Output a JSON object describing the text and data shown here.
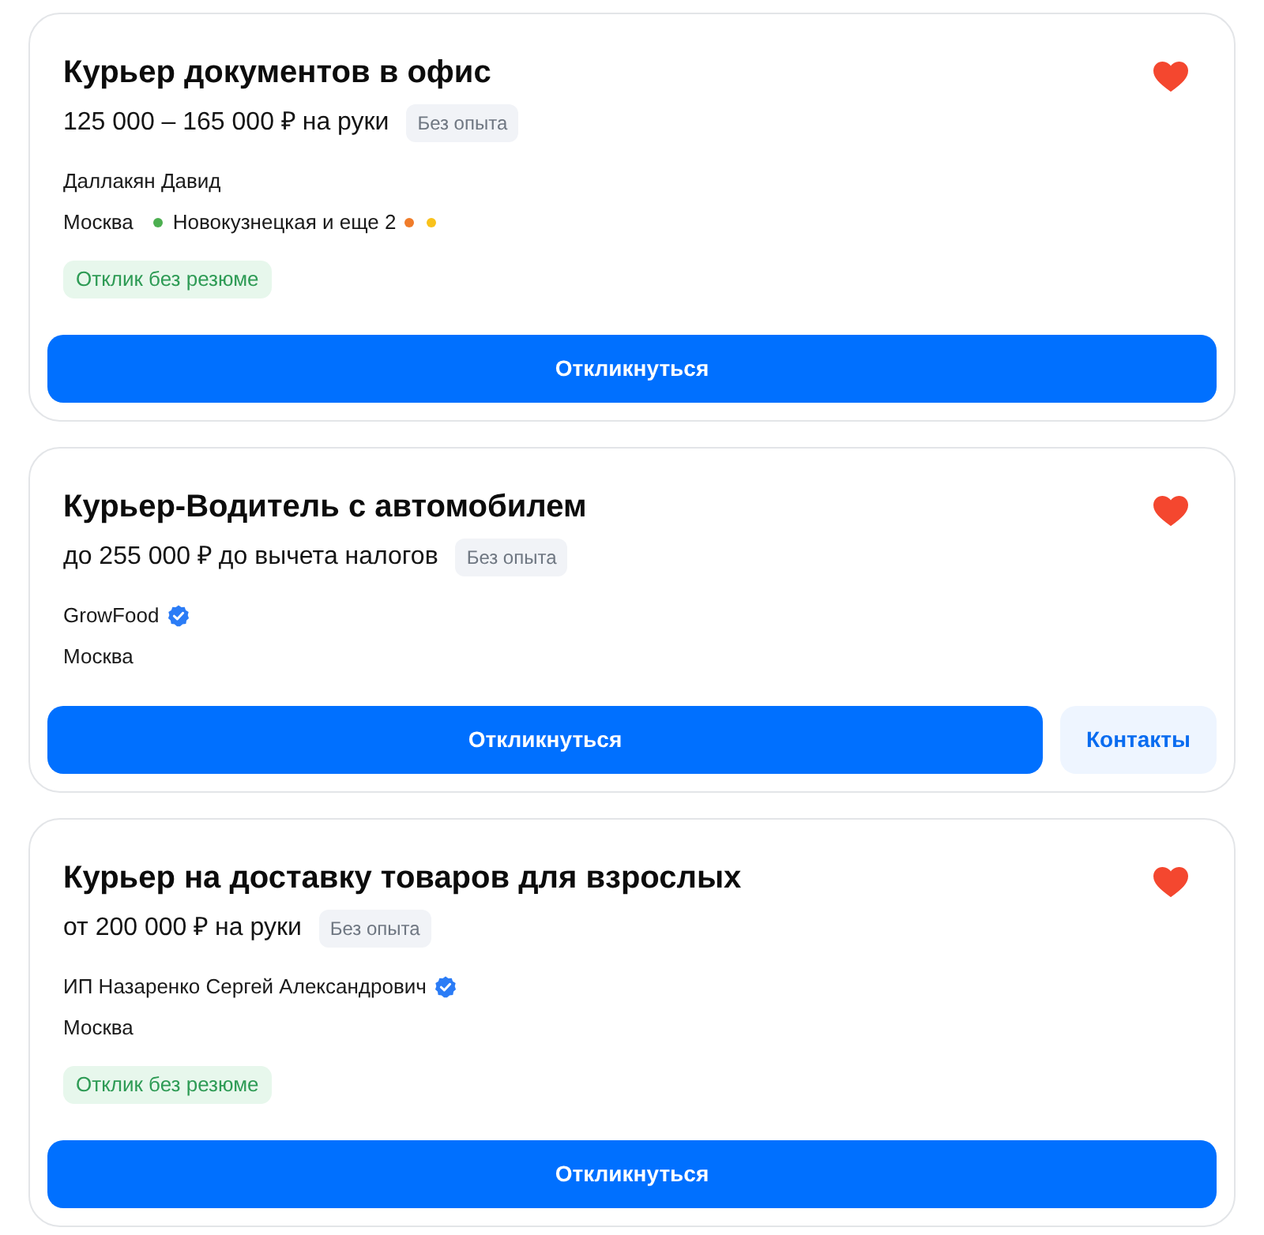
{
  "vacancies": [
    {
      "title": "Курьер документов в офис",
      "favorite": true,
      "salary": "125 000 – 165 000 ₽ на руки",
      "experience_tag": "Без опыта",
      "employer": {
        "name": "Даллакян Давид",
        "verified": false
      },
      "location": {
        "city": "Москва",
        "metro": {
          "label": "Новокузнецкая и еще 2",
          "lines": [
            {
              "color": "#4caf50"
            },
            {
              "color": "#f07c2a"
            },
            {
              "color": "#f9c21b"
            }
          ]
        }
      },
      "response_tag": "Отклик без резюме",
      "buttons": [
        {
          "label": "Откликнуться",
          "kind": "primary"
        }
      ]
    },
    {
      "title": "Курьер-Водитель с автомобилем",
      "favorite": true,
      "salary": "до 255 000 ₽ до вычета налогов",
      "experience_tag": "Без опыта",
      "employer": {
        "name": "GrowFood",
        "verified": true
      },
      "location": {
        "city": "Москва"
      },
      "buttons": [
        {
          "label": "Откликнуться",
          "kind": "primary"
        },
        {
          "label": "Контакты",
          "kind": "secondary"
        }
      ]
    },
    {
      "title": "Курьер на доставку товаров для взрослых",
      "favorite": true,
      "salary": "от 200 000 ₽ на руки",
      "experience_tag": "Без опыта",
      "employer": {
        "name": "ИП Назаренко Сергей Александрович",
        "verified": true
      },
      "location": {
        "city": "Москва"
      },
      "response_tag": "Отклик без резюме",
      "buttons": [
        {
          "label": "Откликнуться",
          "kind": "primary"
        }
      ]
    }
  ]
}
